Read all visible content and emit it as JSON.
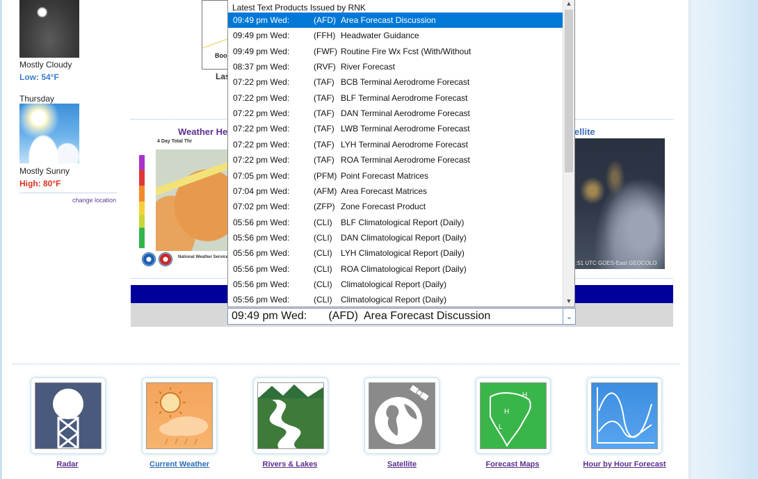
{
  "forecast": {
    "tonight_condition": "Mostly Cloudy",
    "tonight_temp": "Low: 54°F",
    "day_name": "Thursday",
    "day_condition": "Mostly Sunny",
    "day_temp": "High: 80°F",
    "change_location": "change location"
  },
  "panels": {
    "hazard_title": "Weather He",
    "hazard_sub": "4 Day Total Thr",
    "hazard_foot": "National Weather Service",
    "satellite_title": "ellite",
    "satellite_caption": ":51 UTC GOES-East GEOCOLO",
    "top_map_label": "Boo",
    "top_map_caption": "Las"
  },
  "text_products": {
    "header": "Latest Text Products Issued by RNK",
    "selected_value": "09:49 pm Wed:       (AFD)  Area Forecast Discussion",
    "items": [
      {
        "time": "09:49 pm Wed:",
        "code": "(AFD)",
        "name": "Area Forecast Discussion",
        "selected": true
      },
      {
        "time": "09:49 pm Wed:",
        "code": "(FFH)",
        "name": "Headwater Guidance"
      },
      {
        "time": "09:49 pm Wed:",
        "code": "(FWF)",
        "name": "Routine Fire Wx Fcst (With/Without"
      },
      {
        "time": "08:37 pm Wed:",
        "code": "(RVF)",
        "name": "River Forecast"
      },
      {
        "time": "07:22 pm Wed:",
        "code": "(TAF)",
        "name": "BCB Terminal Aerodrome Forecast"
      },
      {
        "time": "07:22 pm Wed:",
        "code": "(TAF)",
        "name": "BLF Terminal Aerodrome Forecast"
      },
      {
        "time": "07:22 pm Wed:",
        "code": "(TAF)",
        "name": "DAN Terminal Aerodrome Forecast"
      },
      {
        "time": "07:22 pm Wed:",
        "code": "(TAF)",
        "name": "LWB Terminal Aerodrome Forecast"
      },
      {
        "time": "07:22 pm Wed:",
        "code": "(TAF)",
        "name": "LYH Terminal Aerodrome Forecast"
      },
      {
        "time": "07:22 pm Wed:",
        "code": "(TAF)",
        "name": "ROA Terminal Aerodrome Forecast"
      },
      {
        "time": "07:05 pm Wed:",
        "code": "(PFM)",
        "name": "Point Forecast Matrices"
      },
      {
        "time": "07:04 pm Wed:",
        "code": "(AFM)",
        "name": "Area Forecast Matrices"
      },
      {
        "time": "07:02 pm Wed:",
        "code": "(ZFP)",
        "name": "Zone Forecast Product"
      },
      {
        "time": "05:56 pm Wed:",
        "code": "(CLI)",
        "name": "BLF Climatological Report (Daily)"
      },
      {
        "time": "05:56 pm Wed:",
        "code": "(CLI)",
        "name": "DAN Climatological Report (Daily)"
      },
      {
        "time": "05:56 pm Wed:",
        "code": "(CLI)",
        "name": "LYH Climatological Report (Daily)"
      },
      {
        "time": "05:56 pm Wed:",
        "code": "(CLI)",
        "name": "ROA Climatological Report (Daily)"
      },
      {
        "time": "05:56 pm Wed:",
        "code": "(CLI)",
        "name": "Climatological Report (Daily)"
      },
      {
        "time": "05:56 pm Wed:",
        "code": "(CLI)",
        "name": "Climatological Report (Daily)"
      }
    ]
  },
  "links": [
    {
      "label": "Radar",
      "icon": "radar-tower-icon"
    },
    {
      "label": "Current Weather",
      "icon": "sun-cloud-icon"
    },
    {
      "label": "Rivers & Lakes",
      "icon": "river-icon"
    },
    {
      "label": "Satellite",
      "icon": "globe-satellite-icon"
    },
    {
      "label": "Forecast Maps",
      "icon": "weather-map-icon"
    },
    {
      "label": "Hour by Hour Forecast",
      "icon": "graph-wave-icon"
    }
  ],
  "colors": {
    "selected_row": "#0078d7",
    "blue_bar": "#00009a",
    "link_purple": "#5a2f8e",
    "link_blue": "#2b6bb5"
  }
}
